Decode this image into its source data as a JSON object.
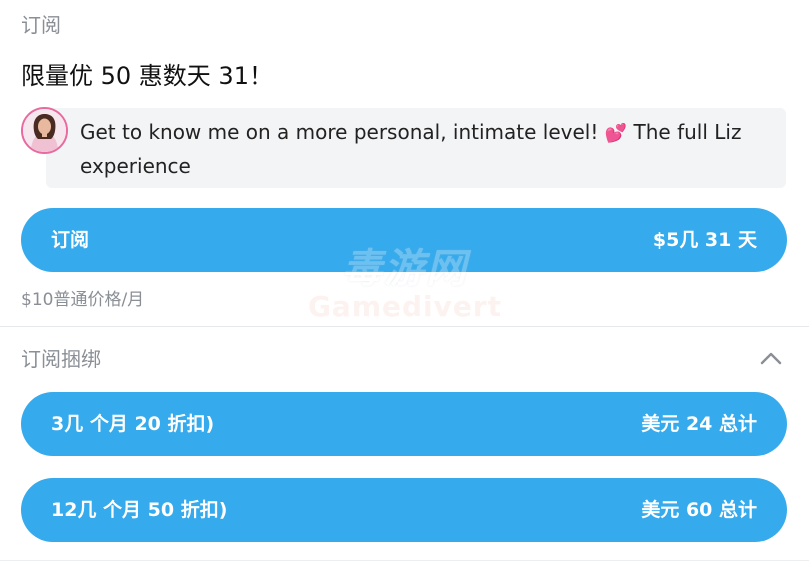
{
  "subscription": {
    "section_title": "订阅",
    "promo_title": "限量优 50 惠数天 31！",
    "message": "Get to know me on a more personal, intimate level! ",
    "message_emoji": "💕",
    "message_tail": " The full Liz experience",
    "button": {
      "label": "订阅",
      "price": "$5几 31 天"
    },
    "regular_price": "$10普通价格/月"
  },
  "bundles": {
    "section_title": "订阅捆绑",
    "items": [
      {
        "label": "3几 个月 20 折扣)",
        "total": "美元 24 总计"
      },
      {
        "label": "12几 个月 50 折扣)",
        "total": "美元 60 总计"
      }
    ]
  },
  "watermark": {
    "top": "毒游网",
    "bottom": "Gamedivert"
  },
  "colors": {
    "accent": "#35aaec",
    "muted_text": "#8a8f96",
    "bubble_bg": "#f3f4f6"
  },
  "icons": {
    "collapse": "chevron-up-icon"
  }
}
